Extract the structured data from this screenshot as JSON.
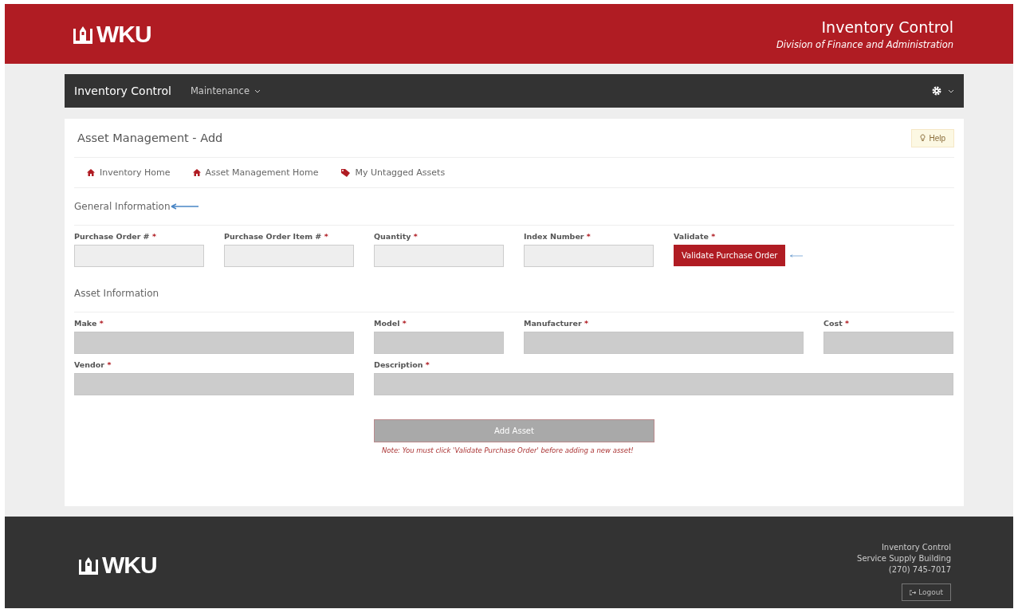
{
  "header": {
    "logo": "WKU",
    "title": "Inventory Control",
    "subtitle": "Division of Finance and Administration"
  },
  "navbar": {
    "brand": "Inventory Control",
    "menus": [
      {
        "label": "Maintenance"
      }
    ]
  },
  "page": {
    "title": "Asset Management - Add",
    "help": "Help",
    "links": [
      {
        "label": "Inventory Home",
        "kind": "home"
      },
      {
        "label": "Asset Management Home",
        "kind": "home"
      },
      {
        "label": "My Untagged Assets",
        "kind": "tag"
      }
    ],
    "sections": [
      {
        "title": "General Information",
        "pointer_arrow": true,
        "rows": [
          [
            {
              "kind": "field",
              "label": "Purchase Order #",
              "required": "*",
              "disabled": false
            },
            {
              "kind": "field",
              "label": "Purchase Order Item #",
              "required": "*",
              "disabled": false
            },
            {
              "kind": "field",
              "label": "Quantity",
              "required": "*",
              "disabled": false
            },
            {
              "kind": "field",
              "label": "Index Number",
              "required": "*",
              "disabled": false
            },
            {
              "kind": "button",
              "label": "Validate",
              "required": "*",
              "button": "Validate Purchase Order",
              "pointer_arrow": true
            }
          ]
        ]
      },
      {
        "title": "Asset Information",
        "pointer_arrow": false,
        "rows": [
          [
            {
              "kind": "field",
              "label": "Make",
              "required": "*",
              "disabled": true
            },
            {
              "kind": "field",
              "label": "Model",
              "required": "*",
              "disabled": true
            },
            {
              "kind": "field",
              "label": "Manufacturer",
              "required": "*",
              "disabled": true
            },
            {
              "kind": "field",
              "label": "Cost",
              "required": "*",
              "disabled": true
            }
          ],
          [
            {
              "kind": "field",
              "label": "Vendor",
              "required": "*",
              "disabled": true
            },
            {
              "kind": "field",
              "label": "Description",
              "required": "*",
              "disabled": true
            }
          ]
        ]
      }
    ],
    "submit": {
      "label": "Add Asset",
      "disabled": true
    },
    "note": "*Note:* You must click 'Validate Purchase Order' before adding a new asset!"
  },
  "footer": {
    "logo": "WKU",
    "lines": [
      "Inventory Control",
      "Service Supply Building",
      "(270) 745-7017"
    ],
    "logout": "Logout"
  }
}
